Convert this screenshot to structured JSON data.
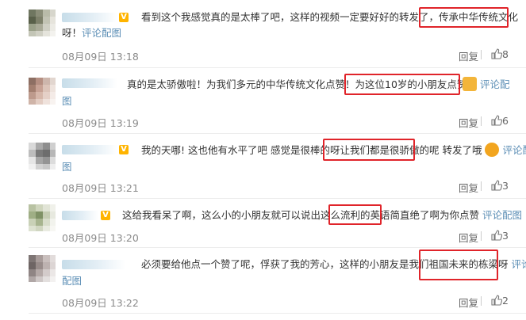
{
  "comments": [
    {
      "text_main": "看到这个我感觉真的是太棒了吧，这样的视频一定要好好的转发了，",
      "text_hl": "传承中华传统文化",
      "line2_prefix": "呀！",
      "action_link": "评论配图",
      "date": "08月09日 13:18",
      "reply_label": "回复",
      "likes": "8"
    },
    {
      "text_main": "真的是太骄傲啦！为我们多元的中华传统文化点赞！",
      "text_hl": "为这位10岁的小朋友点赞！",
      "action_link_a": "评论配",
      "action_link_b": "图",
      "emoji": "thumbs-up-emoji",
      "date": "08月09日 13:19",
      "reply_label": "回复",
      "likes": "6"
    },
    {
      "text_main": "我的天哪! 这也他有水平了吧 感觉是很棒的呀",
      "text_hl": "让我们都是很骄傲的",
      "text_tail": "呢 转发了哦",
      "action_link_a": "评论配",
      "action_link_b": "图",
      "emoji": "laughing-emoji",
      "date": "08月09日 13:21",
      "reply_label": "回复",
      "likes": "3"
    },
    {
      "text_main": "这给我看呆了啊，这么小的小朋友就可以说出这么",
      "text_hl": "流利的英语",
      "text_tail": "简直绝了啊为你点赞",
      "action_link": "评论配图",
      "date": "08月09日 13:20",
      "reply_label": "回复",
      "likes": "3"
    },
    {
      "text_main": "必须要给他点一个赞了呢，俘获了我的芳心，这样的小朋友是我们",
      "text_hl": "祖国未来的栋梁呀",
      "action_link_a": "评论",
      "action_link_b": "配图",
      "date": "08月09日 13:22",
      "reply_label": "回复",
      "likes": "2"
    }
  ],
  "colors": {
    "highlight": "#e0242a",
    "link": "#5d8fb6",
    "date": "#8a8a8a",
    "vip": "#ffb400"
  }
}
